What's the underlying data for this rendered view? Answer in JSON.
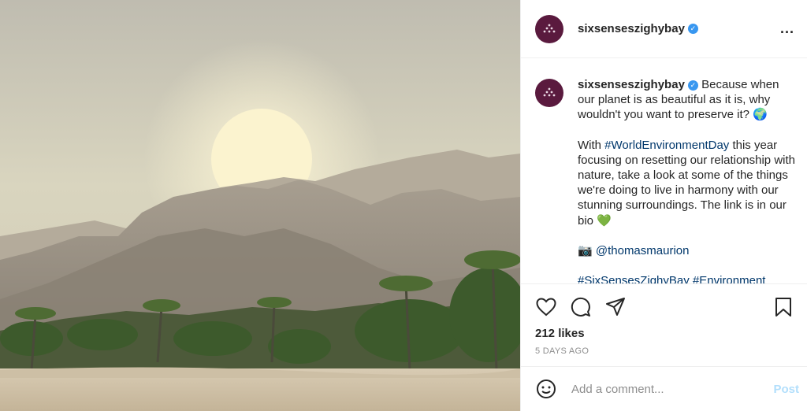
{
  "post": {
    "username": "sixsenseszighybay",
    "verified_mark": "✓",
    "more_icon": "...",
    "caption_lines": [
      "Because when our planet is as beautiful as it is, why wouldn't you want to preserve it? 🌍",
      "this year focusing on resetting our relationship with nature, take a look at some of the things we're doing to live in harmony with our stunning surroundings. The link is in our bio 💚"
    ],
    "caption_with": "With",
    "hashtag_world": "#WorldEnvironmentDay",
    "camera_emoji": "📷",
    "credit": "@thomasmaurion",
    "hashtags_partial": "#SixSensesZighyBay #Environment",
    "likes": "212 likes",
    "time_ago": "5 DAYS AGO",
    "comment_placeholder": "Add a comment...",
    "post_label": "Post"
  },
  "colors": {
    "link": "#00376b",
    "verified": "#3897f0",
    "avatar": "#5a1a3e",
    "post_disabled": "#b2dffc"
  },
  "icons": {
    "like": "heart-icon",
    "comment": "comment-icon",
    "share": "paper-plane-icon",
    "save": "bookmark-icon",
    "emoji": "smiley-icon"
  }
}
